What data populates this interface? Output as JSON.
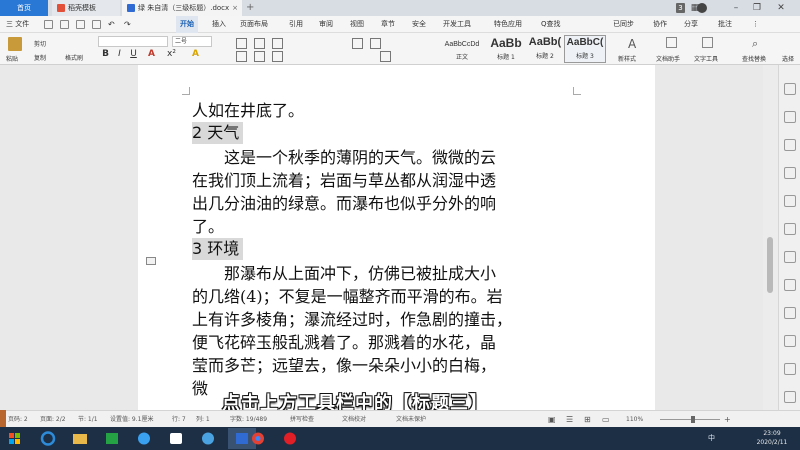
{
  "tabs": [
    {
      "label": "首页"
    },
    {
      "label": "稻壳模板"
    },
    {
      "label": "绿 朱自清（三级标题）.docx"
    }
  ],
  "window": {
    "badge": "3"
  },
  "menu": {
    "file": "三 文件",
    "items": [
      "开始",
      "插入",
      "页面布局",
      "引用",
      "审阅",
      "视图",
      "章节",
      "安全",
      "开发工具",
      "特色应用"
    ],
    "active": "开始",
    "search": "Q查找",
    "sync": "已同步",
    "collab": "协作",
    "share": "分享",
    "comment": "批注"
  },
  "ribbon": {
    "paste": "粘贴",
    "cut": "剪切",
    "copy": "复制",
    "format_painter": "格式刷",
    "font_size": "二号",
    "font_name": "",
    "styles": [
      {
        "preview": "AaBbCcDd",
        "label": "正文"
      },
      {
        "preview": "AaBb",
        "label": "标题 1"
      },
      {
        "preview": "AaBb(",
        "label": "标题 2"
      },
      {
        "preview": "AaBbC(",
        "label": "标题 3"
      }
    ],
    "new_style": "新样式",
    "doc_helper": "文档助手",
    "text_tool": "文字工具",
    "find_replace": "查找替换",
    "select": "选择"
  },
  "document": {
    "lines": [
      {
        "text": "人如在井底了。",
        "kind": "text"
      },
      {
        "text": "2 天气",
        "kind": "heading"
      },
      {
        "text": "　　这是一个秋季的薄阴的天气。微微的云",
        "kind": "text"
      },
      {
        "text": "在我们顶上流着；岩面与草丛都从润湿中透",
        "kind": "text"
      },
      {
        "text": "出几分油油的绿意。而瀑布也似乎分外的响",
        "kind": "text"
      },
      {
        "text": "了。",
        "kind": "text"
      },
      {
        "text": "3 环境",
        "kind": "heading"
      },
      {
        "text": "　　那瀑布从上面冲下，仿佛已被扯成大小",
        "kind": "text"
      },
      {
        "text": "的几绺(4)；不复是一幅整齐而平滑的布。岩",
        "kind": "text"
      },
      {
        "text": "上有许多棱角；瀑流经过时，作急剧的撞击，",
        "kind": "text"
      },
      {
        "text": "便飞花碎玉般乱溅着了。那溅着的水花，晶",
        "kind": "text"
      },
      {
        "text": "莹而多芒；远望去，像一朵朵小小的白梅，",
        "kind": "text"
      },
      {
        "text": "微",
        "kind": "text"
      }
    ],
    "caption": "点击上方工具栏中的【标题三】"
  },
  "status": {
    "page": "页码: 2",
    "pages": "页面: 2/2",
    "section": "节: 1/1",
    "position": "设置值: 9.1厘米",
    "row": "行: 7",
    "col": "列: 1",
    "words": "字数: 19/489",
    "spell": "拼写检查",
    "proof": "文档校对",
    "unsaved": "文档未保护",
    "zoom": "110%",
    "zoom_level": 0.55
  },
  "taskbar": {
    "ime": "中",
    "time": "23:09",
    "date": "2020/2/11"
  }
}
